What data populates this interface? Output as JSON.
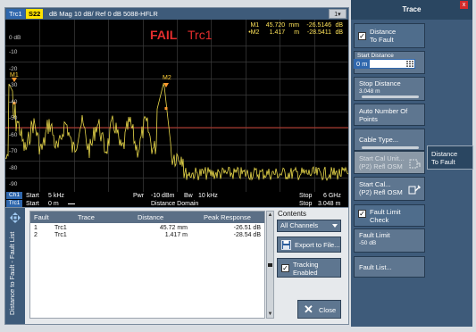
{
  "trace_header": {
    "trace_tag": "Trc1",
    "param_tag": "S22",
    "format_text": "dB Mag   10 dB/ Ref 0 dB   5088-HFLR",
    "expand_label": "1▾"
  },
  "plot": {
    "ref_label": "0 dB",
    "y_ticks": [
      "-10",
      "-20",
      "-30",
      "-40",
      "-50",
      "-60",
      "-70",
      "-80",
      "-90"
    ],
    "fail_text": "FAIL",
    "trace_name": "Trc1",
    "markers": [
      {
        "tag": "M1",
        "readout_name": "M1",
        "distance": "45.720",
        "unit": "mm",
        "value": "-26.5146",
        "value_unit": "dB"
      },
      {
        "tag": "M2",
        "readout_name": "•M2",
        "distance": "1.417",
        "unit": "m",
        "value": "-28.5411",
        "value_unit": "dB"
      }
    ],
    "limit_line_db": -50,
    "colors": {
      "trace": "#e8d84a",
      "limit": "#c0392b",
      "grid": "#3c3c3c",
      "marker": "#ff9a2e"
    }
  },
  "channel_bar": {
    "ch1_tag": "Ch1",
    "start_label": "Start",
    "start_value": "5 kHz",
    "pwr_label": "Pwr",
    "pwr_value": "-10 dBm",
    "bw_label": "Bw",
    "bw_value": "10 kHz",
    "stop_label": "Stop",
    "stop_value": "6 GHz",
    "trc1_tag": "Trc1",
    "start2_label": "Start",
    "start2_value": "0 m",
    "domain_label": "Distance   Domain",
    "stop2_label": "Stop",
    "stop2_value": "3.048 m"
  },
  "dtf_dialog": {
    "vtab_label": "Distance to Fault - Fault List",
    "table": {
      "headers": [
        "Fault",
        "Trace",
        "Distance",
        "Peak Response"
      ],
      "rows": [
        {
          "fault": "1",
          "trace": "Trc1",
          "distance": "45.72 mm",
          "peak": "-26.51 dB"
        },
        {
          "fault": "2",
          "trace": "Trc1",
          "distance": "1.417 m",
          "peak": "-28.54 dB"
        }
      ]
    },
    "scroll_up": "▲",
    "scroll_down": "▼",
    "contents_label": "Contents",
    "contents_value": "All Channels",
    "export_label": "Export to File...",
    "tracking_line1": "Tracking",
    "tracking_line2": "Enabled",
    "tracking_checked": "✓",
    "close_label": "Close",
    "close_icon": "✕"
  },
  "softkeys": {
    "title": "Trace",
    "close_icon": "x",
    "dtf_line1": "Distance",
    "dtf_line2": "To Fault",
    "dtf_checked": "✓",
    "start_distance_label": "Start Distance",
    "start_distance_value": "0 m",
    "stop_distance_label": "Stop Distance",
    "stop_distance_value": "3.048 m",
    "auto_points_line1": "Auto Number Of",
    "auto_points_line2": "Points",
    "cable_type": "Cable Type...",
    "start_cal_unit_line1": "Start Cal Unit...",
    "start_cal_unit_line2": "(P2) Refl OSM",
    "start_cal_line1": "Start Cal...",
    "start_cal_line2": "(P2) Refl OSM",
    "fault_limit_check_line1": "Fault Limit",
    "fault_limit_check_line2": "Check",
    "fault_limit_checked": "✓",
    "fault_limit_label": "Fault Limit",
    "fault_limit_value": "-50 dB",
    "fault_list": "Fault List..."
  },
  "dtf_popup": {
    "line1": "Distance",
    "line2": "To Fault"
  }
}
